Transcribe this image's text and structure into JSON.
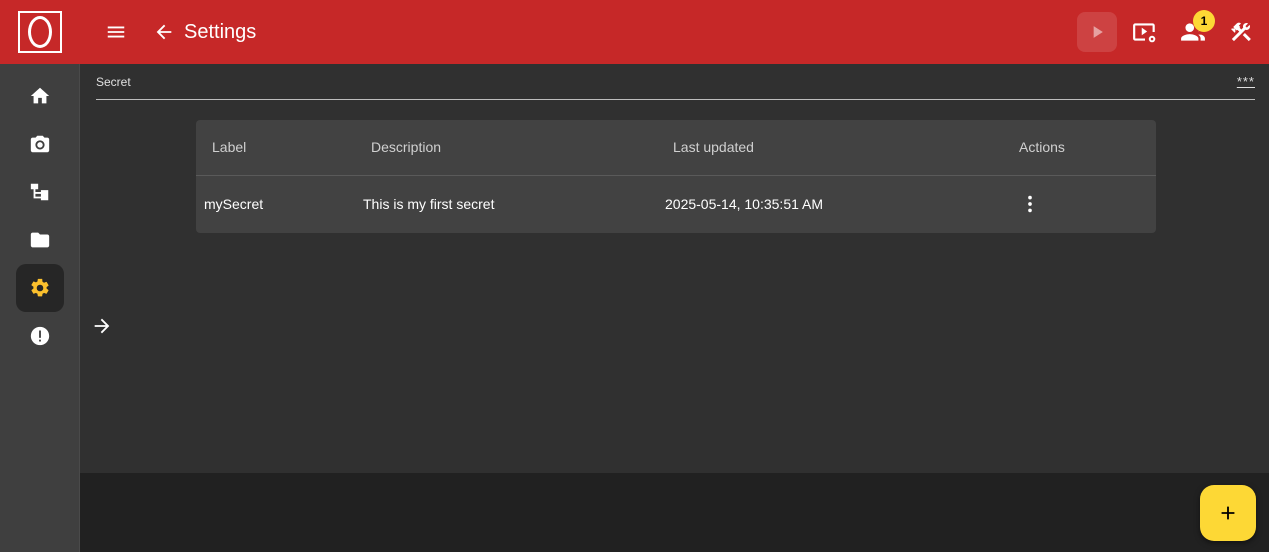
{
  "header": {
    "title": "Settings",
    "notification_count": "1"
  },
  "sidebar": {
    "items": [
      {
        "icon": "home-icon"
      },
      {
        "icon": "camera-icon"
      },
      {
        "icon": "hierarchy-icon"
      },
      {
        "icon": "folder-icon"
      },
      {
        "icon": "gear-icon",
        "active": true
      },
      {
        "icon": "alert-icon"
      }
    ]
  },
  "secret_field": {
    "label": "Secret",
    "mask": "***"
  },
  "table": {
    "columns": [
      "Label",
      "Description",
      "Last updated",
      "Actions"
    ],
    "rows": [
      {
        "label": "mySecret",
        "description": "This is my first secret",
        "last_updated": "2025-05-14, 10:35:51 AM"
      }
    ]
  },
  "colors": {
    "header": "#c62828",
    "accent": "#fdd835",
    "active_icon": "#fbc02d"
  }
}
